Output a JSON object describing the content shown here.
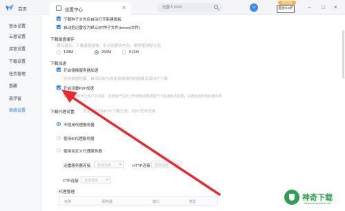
{
  "topbar": {
    "home_label": "首页",
    "tab_label": "设置中心",
    "tab_close": "×",
    "search_placeholder": "迅雷人2020",
    "avatar_text": "U",
    "promo_badge": "限时特惠",
    "promo_label": "超会8.5折",
    "minimize": "−",
    "maximize": "□",
    "close": "×"
  },
  "sidebar": {
    "items": [
      {
        "label": "基本设置"
      },
      {
        "label": "云盘设置"
      },
      {
        "label": "接管设置"
      },
      {
        "label": "下载设置"
      },
      {
        "label": "任务管理"
      },
      {
        "label": "提醒"
      },
      {
        "label": "悬浮窗"
      },
      {
        "label": "高级设置"
      }
    ],
    "active_index": 7
  },
  "content": {
    "download_options": [
      {
        "label": "下载种子文件后自动打开新建面板",
        "checked": true
      },
      {
        "label": "自动把迅雷设为默认BT种子文件(torrent文件)",
        "checked": true
      }
    ],
    "cache": {
      "title": "下载磁盘缓存",
      "hint": "缓存越大，下载速度越快，但占用更多内存，推荐使用默认值",
      "options": [
        "128M",
        "256M",
        "512M"
      ],
      "selected": "256M"
    },
    "accel": {
      "title": "下载加速",
      "mirror_label": "开启镜像服务器加速",
      "mirror_checked": true,
      "mirror_hint": "全网数据挖掘，自动匹配与原始资源相同的镜像资源用户下载",
      "p2p_label": "开启迅雷P2P加速",
      "p2p_checked": true,
      "p2p_hint": "利用P2P技术让用户间加速，该通道产生的上传流量会根据提升下载速度的需要，关闭后会影响加速效果"
    },
    "proxy": {
      "title": "下载代理设置",
      "title_hint": "该设置仅对HTTP下载生效，对BT任务无效",
      "options": [
        "不使用代理服务器",
        "使用IE代理服务器",
        "使用自定义代理服务器"
      ],
      "selected": "不使用代理服务器",
      "fields": {
        "proxy_server_label": "迅雷服务器连接",
        "http_label": "HTTP连接",
        "ftp_label": "FTP连接",
        "select_placeholder": "直接连接"
      }
    },
    "proxy_manage": {
      "title": "代理管理",
      "columns": [
        "名称",
        "服务器",
        "端口",
        "类型"
      ]
    }
  },
  "watermark": {
    "text": "神奇下载",
    "url": "www.shenqixiazai.com"
  },
  "colors": {
    "accent": "#2f7bf5",
    "arrow": "#e8292f",
    "watermark": "#2f9e4f"
  }
}
